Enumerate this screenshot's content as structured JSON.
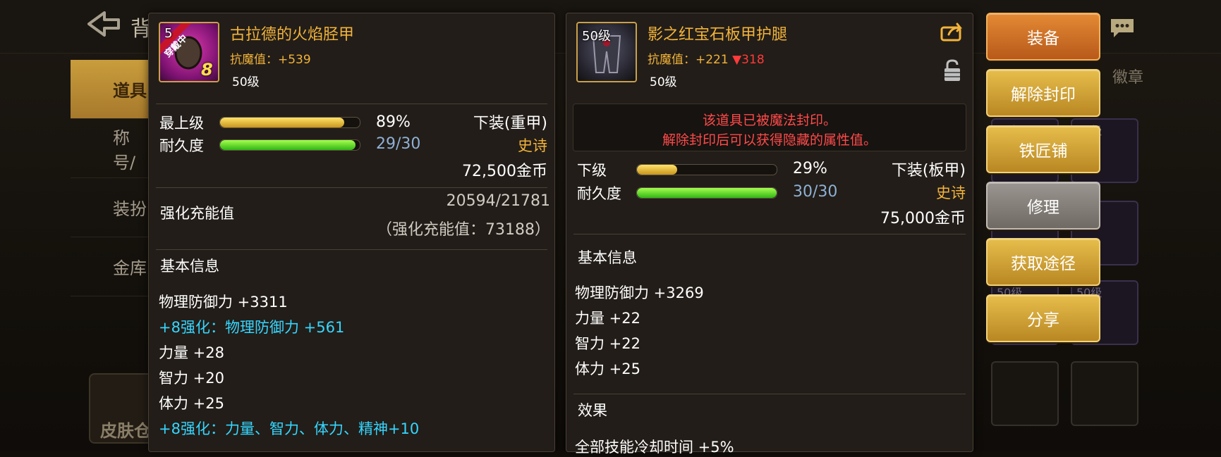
{
  "background": {
    "title": "背",
    "side_tabs": [
      "道具",
      "称号/",
      "装扮",
      "金库"
    ],
    "skin_label": "皮肤仓",
    "top_right_text": "徽章",
    "cells": [
      "50级",
      "50级",
      "50级",
      "50级"
    ]
  },
  "panel1": {
    "name": "古拉德的火焰胫甲",
    "badge_level": "5",
    "badge_equipped": "穿戴中",
    "badge_plus": "8",
    "resist_label": "抗魔值：",
    "resist_value": "+539",
    "level_text": "50级",
    "grade_label": "最上级",
    "grade_pct": "89%",
    "grade_fill": 0.89,
    "dur_label": "耐久度",
    "dur_value": "29/30",
    "dur_fill": 0.97,
    "type": "下装(重甲)",
    "rarity": "史诗",
    "price": "72,500金币",
    "charge_label": "强化充能值",
    "charge_value": "20594/21781",
    "charge_note": "（强化充能值：73188）",
    "basic_title": "基本信息",
    "attrs": [
      {
        "text": "物理防御力 +3311",
        "cyan": false
      },
      {
        "text": "+8强化：物理防御力 +561",
        "cyan": true
      },
      {
        "text": "力量 +28",
        "cyan": false
      },
      {
        "text": "智力 +20",
        "cyan": false
      },
      {
        "text": "体力 +25",
        "cyan": false
      },
      {
        "text": "+8强化：力量、智力、体力、精神+10",
        "cyan": true
      }
    ]
  },
  "panel2": {
    "name": "影之红宝石板甲护腿",
    "badge_level": "50级",
    "resist_label": "抗魔值：",
    "resist_value": "+221",
    "resist_diff": "▼318",
    "level_text": "50级",
    "seal_line1": "该道具已被魔法封印。",
    "seal_line2": "解除封印后可以获得隐藏的属性值。",
    "grade_label": "下级",
    "grade_pct": "29%",
    "grade_fill": 0.29,
    "dur_label": "耐久度",
    "dur_value": "30/30",
    "dur_fill": 1.0,
    "type": "下装(板甲)",
    "rarity": "史诗",
    "price": "75,000金币",
    "basic_title": "基本信息",
    "attrs": [
      "物理防御力 +3269",
      "力量 +22",
      "智力 +22",
      "体力 +25"
    ],
    "effect_title": "效果",
    "effect_text": "全部技能冷却时间 +5%"
  },
  "buttons": {
    "equip": "装备",
    "unseal": "解除封印",
    "smith": "铁匠铺",
    "repair": "修理",
    "source": "获取途径",
    "share": "分享"
  },
  "colors": {
    "gold_text": "#f2b33a",
    "cyan_text": "#35d6ff",
    "red_text": "#ff3a3a",
    "green_bar": "#31b613",
    "gold_bar": "#c9951c"
  }
}
